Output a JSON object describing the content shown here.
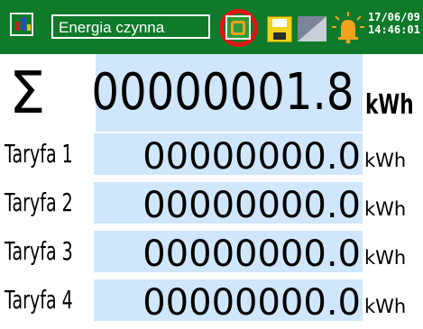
{
  "topbar": {
    "title": "Energia czynna",
    "date": "17/06/09",
    "time": "14:46:01",
    "icons": [
      "app-chart-icon",
      "refresh-icon",
      "save-icon",
      "screen-icon",
      "alarm-bell-icon"
    ],
    "highlight_color": "#e01616",
    "bar_color": "#0f7a2a"
  },
  "total": {
    "symbol": "Σ",
    "value": "00000001.8",
    "unit": "kWh"
  },
  "tariffs": [
    {
      "label": "Taryfa 1",
      "value": "00000000.0",
      "unit": "kWh"
    },
    {
      "label": "Taryfa 2",
      "value": "00000000.0",
      "unit": "kWh"
    },
    {
      "label": "Taryfa 3",
      "value": "00000000.0",
      "unit": "kWh"
    },
    {
      "label": "Taryfa 4",
      "value": "00000000.0",
      "unit": "kWh"
    }
  ],
  "colors": {
    "value_bg": "#cfe6fb"
  }
}
